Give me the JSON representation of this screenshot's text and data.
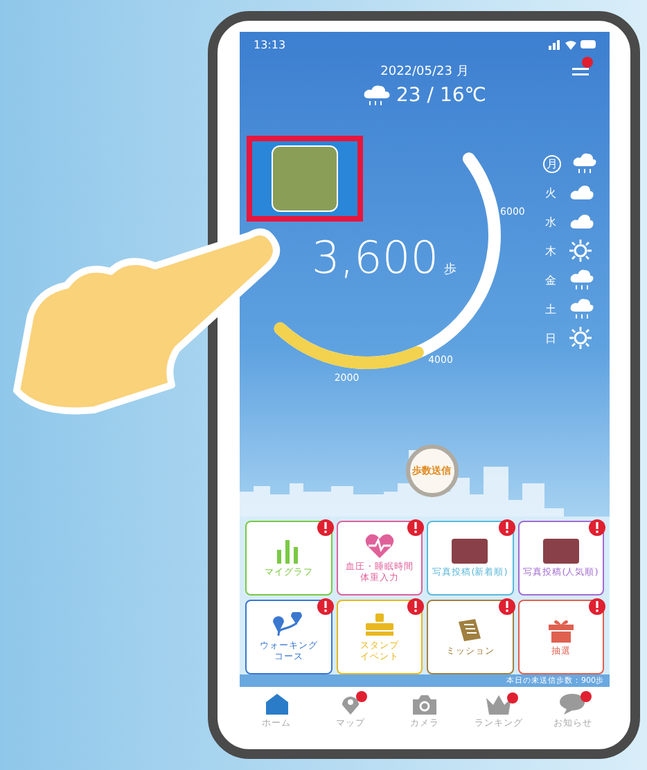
{
  "status_bar": {
    "time": "13:13"
  },
  "header": {
    "date": "2022/05/23 月",
    "weather": "23 / 16℃",
    "menu_badge": true
  },
  "steps": {
    "count": "3,600",
    "unit": "歩",
    "level": 0.39,
    "ticks": [
      "2000",
      "4000",
      "6000"
    ]
  },
  "week": [
    {
      "day": "月",
      "selected": true,
      "kind": "rain"
    },
    {
      "day": "火",
      "selected": false,
      "kind": "cloud"
    },
    {
      "day": "水",
      "selected": false,
      "kind": "cloud"
    },
    {
      "day": "木",
      "selected": false,
      "kind": "sun"
    },
    {
      "day": "金",
      "selected": false,
      "kind": "rain"
    },
    {
      "day": "土",
      "selected": false,
      "kind": "rain"
    },
    {
      "day": "日",
      "selected": false,
      "kind": "sun"
    }
  ],
  "send_button": "歩数送信",
  "tiles": [
    {
      "lines": [
        "マイグラフ"
      ],
      "kind": "chart",
      "color": "#7ac943",
      "alert": true
    },
    {
      "lines": [
        "血圧・睡眠時間",
        "体重入力"
      ],
      "kind": "heart",
      "color": "#e0609a",
      "alert": true
    },
    {
      "lines": [
        "写真投稿(新着順)"
      ],
      "kind": "photo",
      "color": "#5bb8d8",
      "alert": true
    },
    {
      "lines": [
        "写真投稿(人気順)"
      ],
      "kind": "photo",
      "color": "#a36bd0",
      "alert": true
    },
    {
      "lines": [
        "ウォーキング",
        "コース"
      ],
      "kind": "route",
      "color": "#3a78d0",
      "alert": true
    },
    {
      "lines": [
        "スタンプ",
        "イベント"
      ],
      "kind": "stamp",
      "color": "#e8b820",
      "alert": true
    },
    {
      "lines": [
        "ミッション"
      ],
      "kind": "scroll",
      "color": "#a08040",
      "alert": true
    },
    {
      "lines": [
        "抽選"
      ],
      "kind": "gift",
      "color": "#e06050",
      "alert": true
    }
  ],
  "note": "本日の未送信歩数：900歩",
  "tabs": [
    {
      "label": "ホーム",
      "kind": "home",
      "selected": true,
      "badge": false
    },
    {
      "label": "マップ",
      "kind": "pin",
      "selected": false,
      "badge": true
    },
    {
      "label": "カメラ",
      "kind": "camera",
      "selected": false,
      "badge": false
    },
    {
      "label": "ランキング",
      "kind": "crown",
      "selected": false,
      "badge": true
    },
    {
      "label": "お知らせ",
      "kind": "chat",
      "selected": false,
      "badge": true
    }
  ]
}
